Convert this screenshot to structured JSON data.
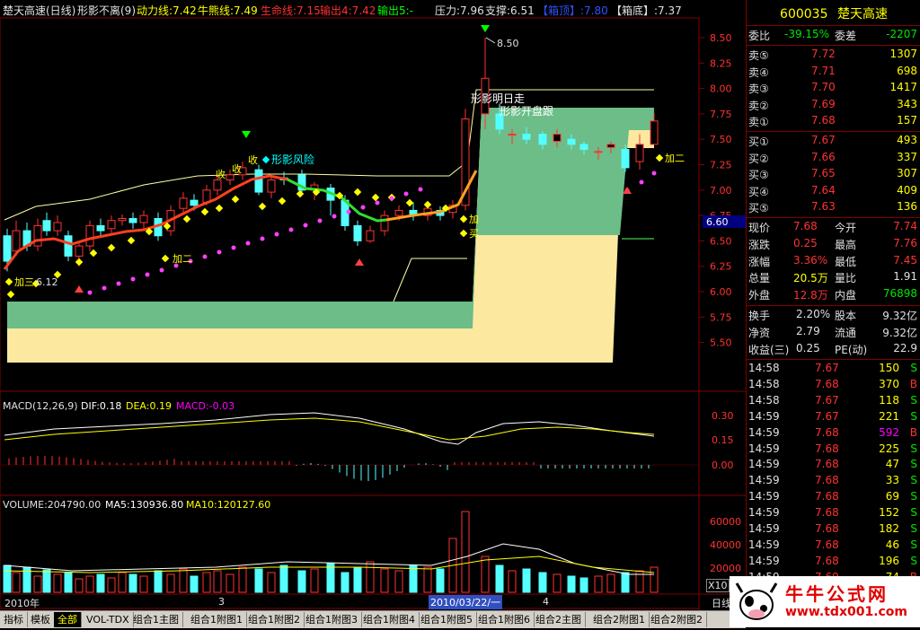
{
  "header": {
    "title": "楚天高速(日线)",
    "indicator": "形影不离(9)",
    "items": [
      {
        "label": "动力线:7.42",
        "color": "#ffff00"
      },
      {
        "label": "牛熊线:7.49",
        "color": "#ffff00"
      },
      {
        "label": "生命线:7.15",
        "color": "#ff3030"
      },
      {
        "label": "输出4:7.42",
        "color": "#ff3030"
      },
      {
        "label": "输出5:-",
        "color": "#00ff00"
      },
      {
        "label": "压力:7.96",
        "color": "#e0e0e0"
      },
      {
        "label": "支撑:6.51",
        "color": "#e0e0e0"
      },
      {
        "label": "【箱顶】:7.80",
        "color": "#3050ff"
      },
      {
        "label": "【箱底】:7.37",
        "color": "#e0e0e0"
      }
    ]
  },
  "chart_annotations": {
    "high_label": "8.50",
    "low_label": "6.12",
    "current_price_tag": "6.60",
    "texts": [
      "形影明日走",
      "形影开盘跟",
      "形影风险",
      "收",
      "收",
      "收",
      "加二",
      "加三",
      "加二",
      "买",
      "加",
      "加二"
    ]
  },
  "price_axis": [
    "8.50",
    "8.25",
    "8.00",
    "7.75",
    "7.50",
    "7.25",
    "7.00",
    "6.75",
    "6.50",
    "6.25",
    "6.00",
    "5.75",
    "5.50"
  ],
  "macd": {
    "title": "MACD(12,26,9)",
    "dif": "DIF:0.18",
    "dea": "DEA:0.19",
    "macd": "MACD:-0.03",
    "axis": [
      "0.30",
      "0.15",
      "0.00"
    ]
  },
  "volume": {
    "title": "VOLUME:204790.00",
    "ma5": "MA5:130936.80",
    "ma10": "MA10:120127.60",
    "axis": [
      "60000",
      "40000",
      "20000"
    ],
    "unit": "X10"
  },
  "time_axis": {
    "left": "2010年",
    "mid1": "3",
    "highlight": "2010/03/22/一",
    "mid2": "4",
    "period": "日线"
  },
  "colors": {
    "up": "#ff3232",
    "down": "#54ffff",
    "box_green": "#6cbd87",
    "box_yellow": "#fde8a0"
  },
  "quote": {
    "code": "600035",
    "name": "楚天高速",
    "weibi_label": "委比",
    "weibi_val": "-39.15%",
    "weicha_label": "委差",
    "weicha_val": "-2207",
    "sells": [
      {
        "label": "卖⑤",
        "price": "7.72",
        "vol": "1307"
      },
      {
        "label": "卖④",
        "price": "7.71",
        "vol": "698"
      },
      {
        "label": "卖③",
        "price": "7.70",
        "vol": "1417"
      },
      {
        "label": "卖②",
        "price": "7.69",
        "vol": "343"
      },
      {
        "label": "卖①",
        "price": "7.68",
        "vol": "157"
      }
    ],
    "buys": [
      {
        "label": "买①",
        "price": "7.67",
        "vol": "493"
      },
      {
        "label": "买②",
        "price": "7.66",
        "vol": "337"
      },
      {
        "label": "买③",
        "price": "7.65",
        "vol": "307"
      },
      {
        "label": "买④",
        "price": "7.64",
        "vol": "409"
      },
      {
        "label": "买⑤",
        "price": "7.63",
        "vol": "136"
      }
    ],
    "stats": [
      {
        "l1": "现价",
        "v1": "7.68",
        "c1": "red",
        "l2": "今开",
        "v2": "7.74",
        "c2": "red"
      },
      {
        "l1": "涨跌",
        "v1": "0.25",
        "c1": "red",
        "l2": "最高",
        "v2": "7.76",
        "c2": "red"
      },
      {
        "l1": "涨幅",
        "v1": "3.36%",
        "c1": "red",
        "l2": "最低",
        "v2": "7.45",
        "c2": "red"
      },
      {
        "l1": "总量",
        "v1": "20.5万",
        "c1": "yel",
        "l2": "量比",
        "v2": "1.91",
        "c2": "wht"
      },
      {
        "l1": "外盘",
        "v1": "12.8万",
        "c1": "red",
        "l2": "内盘",
        "v2": "76898",
        "c2": "grn"
      }
    ],
    "stats2": [
      {
        "l1": "换手",
        "v1": "2.20%",
        "l2": "股本",
        "v2": "9.32亿"
      },
      {
        "l1": "净资",
        "v1": "2.79",
        "l2": "流通",
        "v2": "9.32亿"
      },
      {
        "l1": "收益(三)",
        "v1": "0.25",
        "l2": "PE(动)",
        "v2": "22.9"
      }
    ],
    "ticks": [
      {
        "t": "14:58",
        "p": "7.67",
        "v": "150",
        "s": "S"
      },
      {
        "t": "14:58",
        "p": "7.68",
        "v": "370",
        "s": "B"
      },
      {
        "t": "14:58",
        "p": "7.67",
        "v": "118",
        "s": "S"
      },
      {
        "t": "14:59",
        "p": "7.67",
        "v": "221",
        "s": "S"
      },
      {
        "t": "14:59",
        "p": "7.68",
        "v": "592",
        "s": "B"
      },
      {
        "t": "14:59",
        "p": "7.68",
        "v": "225",
        "s": "S"
      },
      {
        "t": "14:59",
        "p": "7.68",
        "v": "47",
        "s": "S"
      },
      {
        "t": "14:59",
        "p": "7.68",
        "v": "33",
        "s": "S"
      },
      {
        "t": "14:59",
        "p": "7.68",
        "v": "69",
        "s": "S"
      },
      {
        "t": "14:59",
        "p": "7.68",
        "v": "152",
        "s": "S"
      },
      {
        "t": "14:59",
        "p": "7.68",
        "v": "182",
        "s": "S"
      },
      {
        "t": "14:59",
        "p": "7.68",
        "v": "46",
        "s": "S"
      },
      {
        "t": "14:59",
        "p": "7.68",
        "v": "196",
        "s": "S"
      },
      {
        "t": "14:59",
        "p": "7.69",
        "v": "74",
        "s": "B"
      }
    ]
  },
  "tabs": [
    "指标",
    "模板",
    "全部",
    "VOL-TDX",
    "组合1主图",
    "组合1附图1",
    "组合1附图2",
    "组合1附图3",
    "组合1附图4",
    "组合1附图5",
    "组合1附图6",
    "组合2主图",
    "组合2附图1",
    "组合2附图2"
  ],
  "watermark": {
    "line1": "牛牛公式网",
    "line2": "www.tdx001.com"
  }
}
